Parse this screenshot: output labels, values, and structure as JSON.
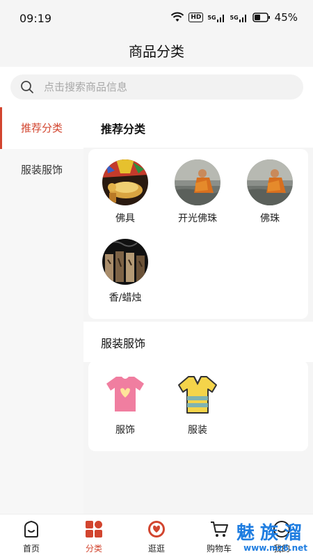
{
  "status_bar": {
    "time": "09:19",
    "hd": "HD",
    "signal_a": "5G",
    "signal_b": "5G",
    "battery": "45%"
  },
  "header": {
    "title": "商品分类"
  },
  "search": {
    "placeholder": "点击搜索商品信息"
  },
  "sidebar": {
    "items": [
      {
        "label": "推荐分类",
        "active": true
      },
      {
        "label": "服装服饰",
        "active": false
      }
    ]
  },
  "sections": [
    {
      "title": "推荐分类",
      "items": [
        {
          "label": "佛具",
          "icon": "buddhist-tools-image"
        },
        {
          "label": "开光佛珠",
          "icon": "monk-image"
        },
        {
          "label": "佛珠",
          "icon": "monk-image"
        },
        {
          "label": "香/蜡烛",
          "icon": "incense-image"
        }
      ]
    },
    {
      "title": "服装服饰",
      "items": [
        {
          "label": "服饰",
          "icon": "pink-tshirt-icon"
        },
        {
          "label": "服装",
          "icon": "striped-shirt-icon"
        }
      ]
    }
  ],
  "tabbar": {
    "tabs": [
      {
        "label": "首页",
        "active": false
      },
      {
        "label": "分类",
        "active": true
      },
      {
        "label": "逛逛",
        "active": false
      },
      {
        "label": "购物车",
        "active": false
      },
      {
        "label": "我的",
        "active": false
      }
    ]
  },
  "watermark": {
    "title": "魅族溜",
    "url": "www.mz6.net"
  },
  "colors": {
    "accent": "#d2452f",
    "watermark": "#1f7de0"
  }
}
